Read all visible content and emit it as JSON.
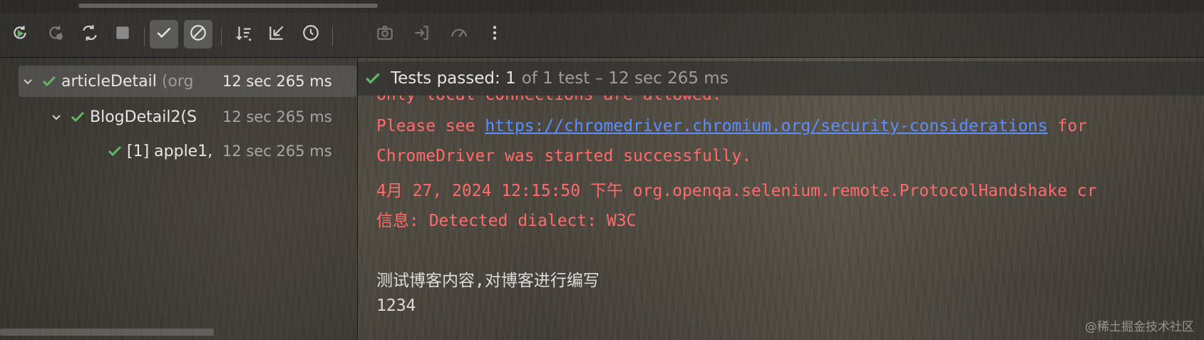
{
  "toolbar": {
    "buttons": [
      {
        "name": "rerun-icon"
      },
      {
        "name": "rerun-failed-icon"
      },
      {
        "name": "toggle-auto-test-icon"
      },
      {
        "name": "stop-icon"
      },
      {
        "name": "show-passed-icon",
        "active": true
      },
      {
        "name": "show-ignored-icon",
        "active": true
      },
      {
        "name": "sort-icon"
      },
      {
        "name": "collapse-icon"
      },
      {
        "name": "history-icon"
      },
      {
        "name": "screenshot-icon"
      },
      {
        "name": "import-icon"
      },
      {
        "name": "speedometer-icon"
      },
      {
        "name": "more-icon"
      }
    ]
  },
  "tree": [
    {
      "name": "articleDetail",
      "suffix": " (org",
      "time": "12 sec 265 ms",
      "selected": true,
      "level": 0
    },
    {
      "name": "BlogDetail2(S",
      "suffix": "",
      "time": "12 sec 265 ms",
      "selected": false,
      "level": 1
    },
    {
      "name": "[1] apple1,",
      "suffix": "",
      "time": "12 sec 265 ms",
      "selected": false,
      "level": 2
    }
  ],
  "status": {
    "label": "Tests passed: 1",
    "detail": "of 1 test – 12 sec 265 ms"
  },
  "console": {
    "line0": "Only local connections are allowed.",
    "line1_prefix": "Please see ",
    "line1_link": "https://chromedriver.chromium.org/security-considerations",
    "line1_suffix": " for",
    "line2": "ChromeDriver was started successfully.",
    "line3": "4月 27, 2024 12:15:50 下午 org.openqa.selenium.remote.ProtocolHandshake cr",
    "line4": "信息: Detected dialect: W3C",
    "line5": "测试博客内容,对博客进行编写",
    "line6": "1234"
  },
  "watermark": "@稀土掘金技术社区",
  "colors": {
    "pass_green": "#5fb865",
    "console_red": "#ff6b6b",
    "link_blue": "#5b8fff"
  }
}
